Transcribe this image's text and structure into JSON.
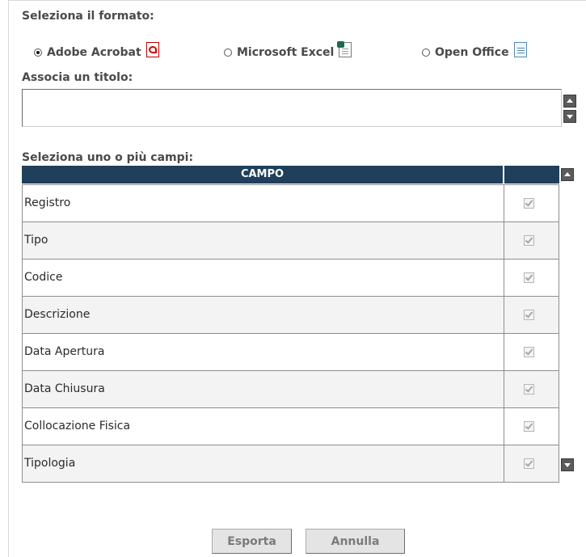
{
  "format": {
    "label": "Seleziona il formato:",
    "options": [
      {
        "label": "Adobe Acrobat",
        "selected": true,
        "icon": "pdf-icon"
      },
      {
        "label": "Microsoft Excel",
        "selected": false,
        "icon": "excel-icon"
      },
      {
        "label": "Open Office",
        "selected": false,
        "icon": "openoffice-icon"
      }
    ]
  },
  "title": {
    "label": "Associa un titolo:",
    "value": ""
  },
  "fields": {
    "label": "Seleziona uno o più campi:",
    "column_header": "CAMPO",
    "rows": [
      {
        "name": "Registro",
        "checked": true
      },
      {
        "name": "Tipo",
        "checked": true
      },
      {
        "name": "Codice",
        "checked": true
      },
      {
        "name": "Descrizione",
        "checked": true
      },
      {
        "name": "Data Apertura",
        "checked": true
      },
      {
        "name": "Data Chiusura",
        "checked": true
      },
      {
        "name": "Collocazione Fisica",
        "checked": true
      },
      {
        "name": "Tipologia",
        "checked": true
      }
    ]
  },
  "actions": {
    "export_label": "Esporta",
    "cancel_label": "Annulla"
  },
  "colors": {
    "header_bg": "#1f3f5b",
    "scroll_button": "#5b5b5b"
  }
}
